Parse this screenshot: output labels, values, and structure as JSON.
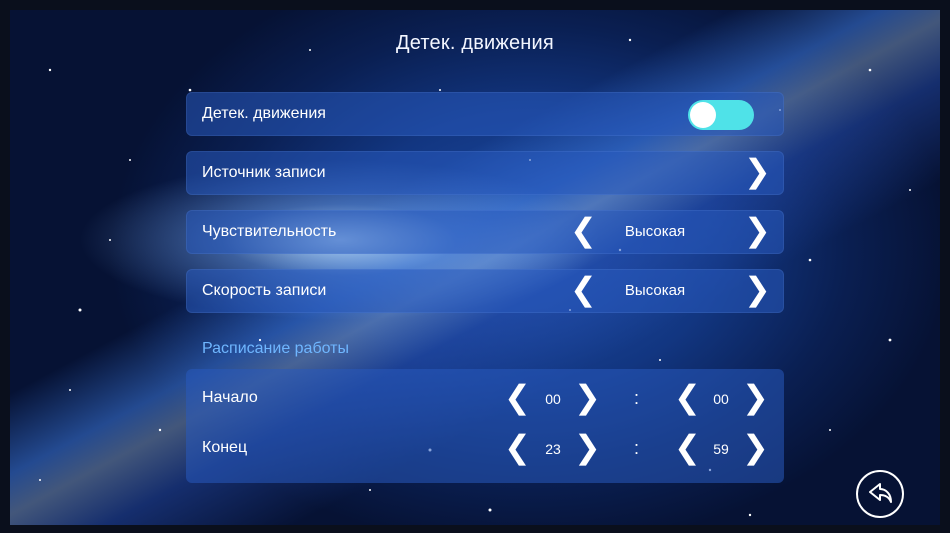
{
  "header": {
    "title": "Детек. движения"
  },
  "settings": {
    "motion_detection": {
      "label": "Детек. движения",
      "enabled": true
    },
    "record_source": {
      "label": "Источник записи"
    },
    "sensitivity": {
      "label": "Чувствительность",
      "value": "Высокая"
    },
    "record_speed": {
      "label": "Скорость записи",
      "value": "Высокая"
    }
  },
  "schedule": {
    "section_label": "Расписание работы",
    "start": {
      "label": "Начало",
      "hour": "00",
      "minute": "00"
    },
    "end": {
      "label": "Конец",
      "hour": "23",
      "minute": "59"
    }
  },
  "icons": {
    "back": "back-arrow-icon",
    "next": "chevron-right-icon",
    "prev": "chevron-left-icon"
  },
  "colors": {
    "toggle_on": "#4fe2e8",
    "section_label": "#6fb6ff",
    "panel": "#285abe"
  }
}
